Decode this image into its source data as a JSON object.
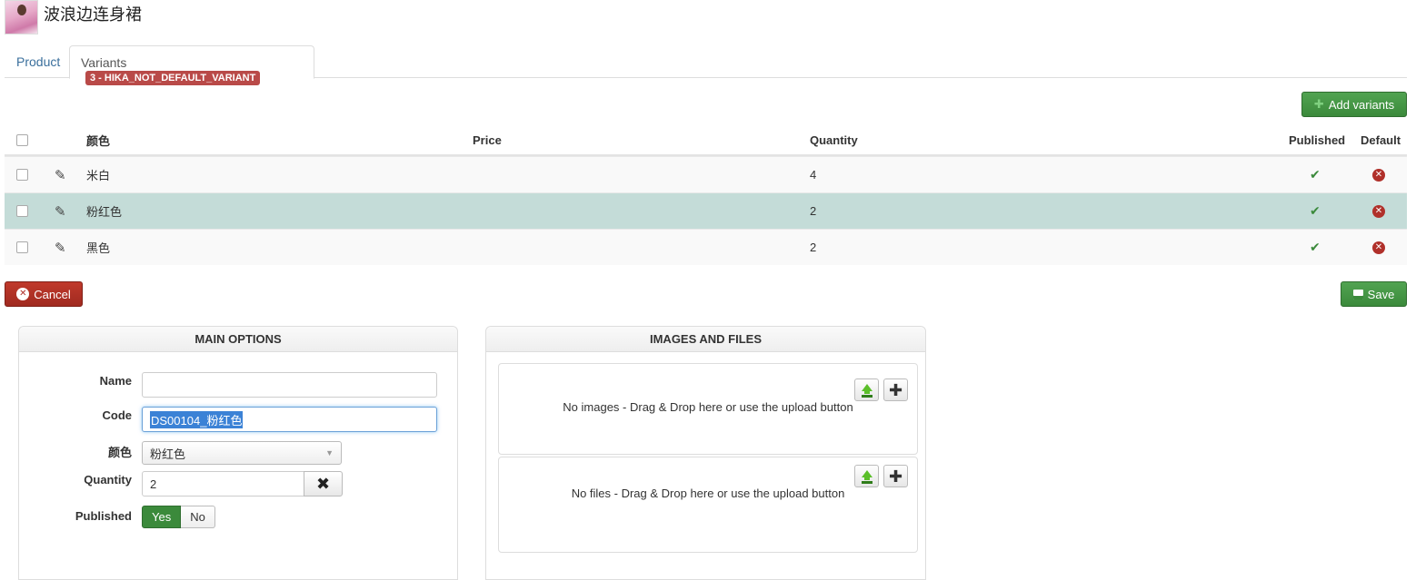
{
  "header": {
    "title": "波浪边连身裙"
  },
  "tabs": [
    {
      "label": "Product"
    },
    {
      "label": "Variants",
      "badge": "3 - HIKA_NOT_DEFAULT_VARIANT"
    }
  ],
  "toolbar": {
    "add_variants": "Add variants",
    "cancel": "Cancel",
    "save": "Save"
  },
  "table": {
    "columns": {
      "color": "颜色",
      "price": "Price",
      "quantity": "Quantity",
      "published": "Published",
      "default": "Default"
    },
    "rows": [
      {
        "color": "米白",
        "price": "",
        "quantity": "4"
      },
      {
        "color": "粉红色",
        "price": "",
        "quantity": "2"
      },
      {
        "color": "黑色",
        "price": "",
        "quantity": "2"
      }
    ]
  },
  "main_options": {
    "title": "MAIN OPTIONS",
    "name_label": "Name",
    "name_value": "",
    "code_label": "Code",
    "code_value": "DS00104_粉红色",
    "color_label": "颜色",
    "color_value": "粉红色",
    "quantity_label": "Quantity",
    "quantity_value": "2",
    "published_label": "Published",
    "yes": "Yes",
    "no": "No"
  },
  "images_files": {
    "title": "IMAGES AND FILES",
    "images_empty": "No images - Drag & Drop here or use the upload button",
    "files_empty": "No files - Drag & Drop here or use the upload button"
  },
  "colors": {
    "green": "#3b8a3b",
    "red": "#b0302a",
    "selected_row": "#c4dcd8"
  }
}
